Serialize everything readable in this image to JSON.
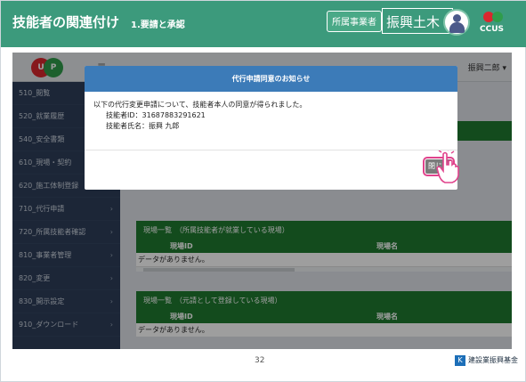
{
  "slide": {
    "title": "技能者の関連付け",
    "subtitle": "1.要請と承認",
    "badge": "所属事業者",
    "org": "振興土木",
    "page_number": "32",
    "foot_org": "建設業振興基金",
    "ccus": "CCUS"
  },
  "app": {
    "logo_a": "U",
    "logo_b": "P",
    "user": "振興二郎 ▾",
    "menu_icon": "≡"
  },
  "sidebar": {
    "items": [
      {
        "label": "510_閲覧",
        "arrow": ""
      },
      {
        "label": "520_就業履歴",
        "arrow": ""
      },
      {
        "label": "540_安全書類",
        "arrow": ""
      },
      {
        "label": "610_現場・契約",
        "arrow": ""
      },
      {
        "label": "620_施工体制登録",
        "arrow": ""
      },
      {
        "label": "710_代行申請",
        "arrow": "›"
      },
      {
        "label": "720_所属技能者確認",
        "arrow": "›"
      },
      {
        "label": "810_事業者管理",
        "arrow": "›"
      },
      {
        "label": "820_変更",
        "arrow": "›"
      },
      {
        "label": "830_開示設定",
        "arrow": "›"
      },
      {
        "label": "910_ダウンロード",
        "arrow": "›"
      }
    ]
  },
  "main": {
    "sections": [
      {
        "title": "現場一覧　（所属技能者が就業している現場）",
        "col1": "現場ID",
        "col2": "現場名",
        "empty": "データがありません。"
      },
      {
        "title": "現場一覧　（元請として登録している現場）",
        "col1": "現場ID",
        "col2": "現場名",
        "empty": "データがありません。"
      }
    ]
  },
  "modal": {
    "title": "代行申請同意のお知らせ",
    "line1": "以下の代行変更申請について、技能者本人の同意が得られました。",
    "line2": "技能者ID：31687883291621",
    "line3": "技能者氏名：振興 九郎",
    "close": "閉じる"
  },
  "colors": {
    "header": "#3c9a7c",
    "sidebar": "#2e3e5a",
    "modal_title": "#3c7bb8",
    "green": "#1f7a2f"
  }
}
